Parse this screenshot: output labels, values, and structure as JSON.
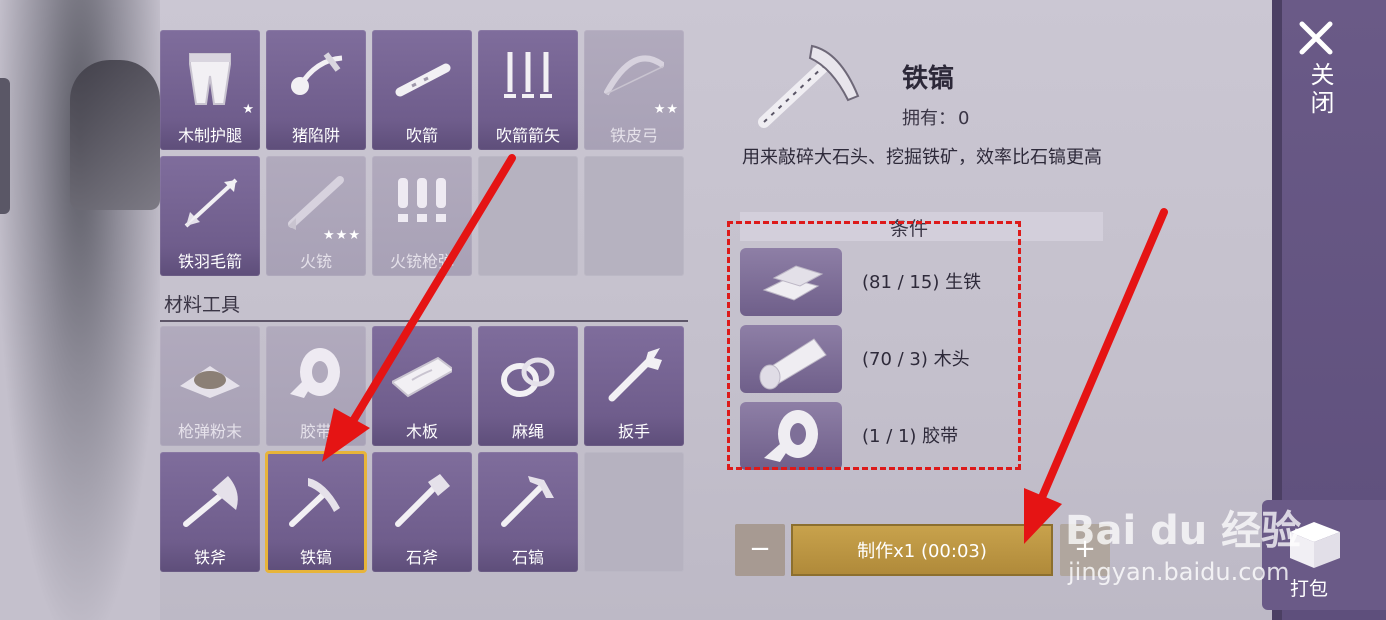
{
  "grid_top": [
    {
      "label": "木制护腿",
      "icon": "leg-armor-icon",
      "state": "active",
      "stars": "★"
    },
    {
      "label": "猪陷阱",
      "icon": "pig-trap-icon",
      "state": "active",
      "stars": ""
    },
    {
      "label": "吹箭",
      "icon": "blowgun-icon",
      "state": "active",
      "stars": ""
    },
    {
      "label": "吹箭箭矢",
      "icon": "dart-icon",
      "state": "active",
      "stars": ""
    },
    {
      "label": "铁皮弓",
      "icon": "bow-icon",
      "state": "dim",
      "stars": "★★"
    },
    {
      "label": "铁羽毛箭",
      "icon": "arrow-icon",
      "state": "active",
      "stars": ""
    },
    {
      "label": "火铳",
      "icon": "musket-icon",
      "state": "dim",
      "stars": "★★★"
    },
    {
      "label": "火铳枪弹",
      "icon": "bullets-icon",
      "state": "dim",
      "stars": ""
    },
    {
      "label": "",
      "icon": "",
      "state": "empty",
      "stars": ""
    },
    {
      "label": "",
      "icon": "",
      "state": "empty",
      "stars": ""
    }
  ],
  "section_title": "材料工具",
  "grid_bottom": [
    {
      "label": "枪弹粉末",
      "icon": "gunpowder-icon",
      "state": "dim"
    },
    {
      "label": "胶带",
      "icon": "tape-icon",
      "state": "dim"
    },
    {
      "label": "木板",
      "icon": "plank-icon",
      "state": "active"
    },
    {
      "label": "麻绳",
      "icon": "rope-icon",
      "state": "active"
    },
    {
      "label": "扳手",
      "icon": "wrench-icon",
      "state": "active"
    },
    {
      "label": "铁斧",
      "icon": "iron-axe-icon",
      "state": "active"
    },
    {
      "label": "铁镐",
      "icon": "iron-pickaxe-icon",
      "state": "selected"
    },
    {
      "label": "石斧",
      "icon": "stone-axe-icon",
      "state": "active"
    },
    {
      "label": "石镐",
      "icon": "stone-pickaxe-icon",
      "state": "active"
    },
    {
      "label": "",
      "icon": "",
      "state": "empty"
    }
  ],
  "detail": {
    "name": "铁镐",
    "owned_label": "拥有：",
    "owned_value": "0",
    "description": "用来敲碎大石头、挖掘铁矿，效率比石镐更高",
    "conditions_title": "条件",
    "requirements": [
      {
        "text": "(81 / 15) 生铁",
        "icon": "iron-ingot-icon"
      },
      {
        "text": "(70 / 3) 木头",
        "icon": "wood-log-icon"
      },
      {
        "text": "(1 / 1) 胶带",
        "icon": "tape-icon"
      }
    ]
  },
  "actions": {
    "minus": "−",
    "make": "制作x1 (00:03)",
    "plus": "+"
  },
  "rail": {
    "close_label": "关闭",
    "pack_label": "打包"
  },
  "watermark": {
    "logo": "Bai du 经验",
    "url": "jingyan.baidu.com"
  },
  "colors": {
    "slot": "#7f6d9c",
    "selected": "#e7b43a",
    "rail": "#6a5a87",
    "make": "#c8a24c",
    "annotation": "#dd1a1a"
  }
}
